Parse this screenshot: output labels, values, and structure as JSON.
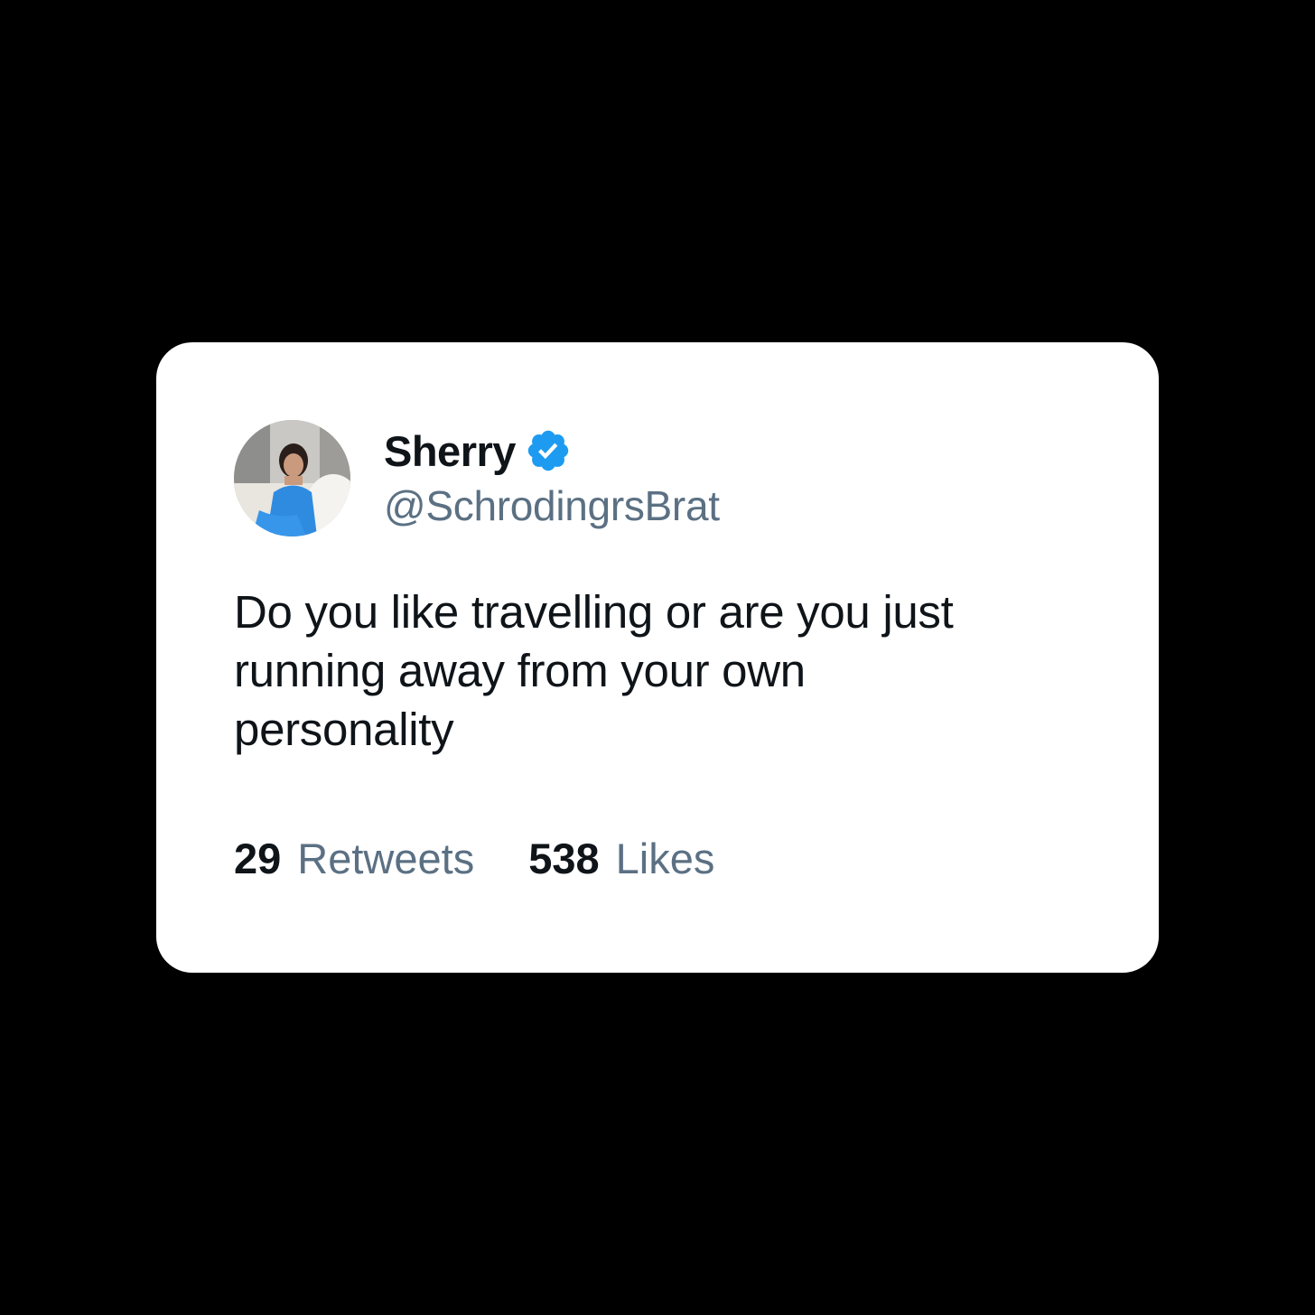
{
  "tweet": {
    "author": {
      "display_name": "Sherry",
      "handle": "@SchrodingrsBrat",
      "verified": true,
      "avatar": "profile-photo"
    },
    "text_lines": [
      "Do you like travelling or are you just",
      "running away from your own",
      "personality"
    ],
    "stats": {
      "retweets_count": "29",
      "retweets_label": "Retweets",
      "likes_count": "538",
      "likes_label": "Likes"
    }
  },
  "colors": {
    "background": "#000000",
    "card": "#ffffff",
    "text_primary": "#0f1419",
    "text_secondary": "#5b7083",
    "verified_badge": "#1d9bf0"
  },
  "icons": [
    "verified-badge-icon"
  ]
}
